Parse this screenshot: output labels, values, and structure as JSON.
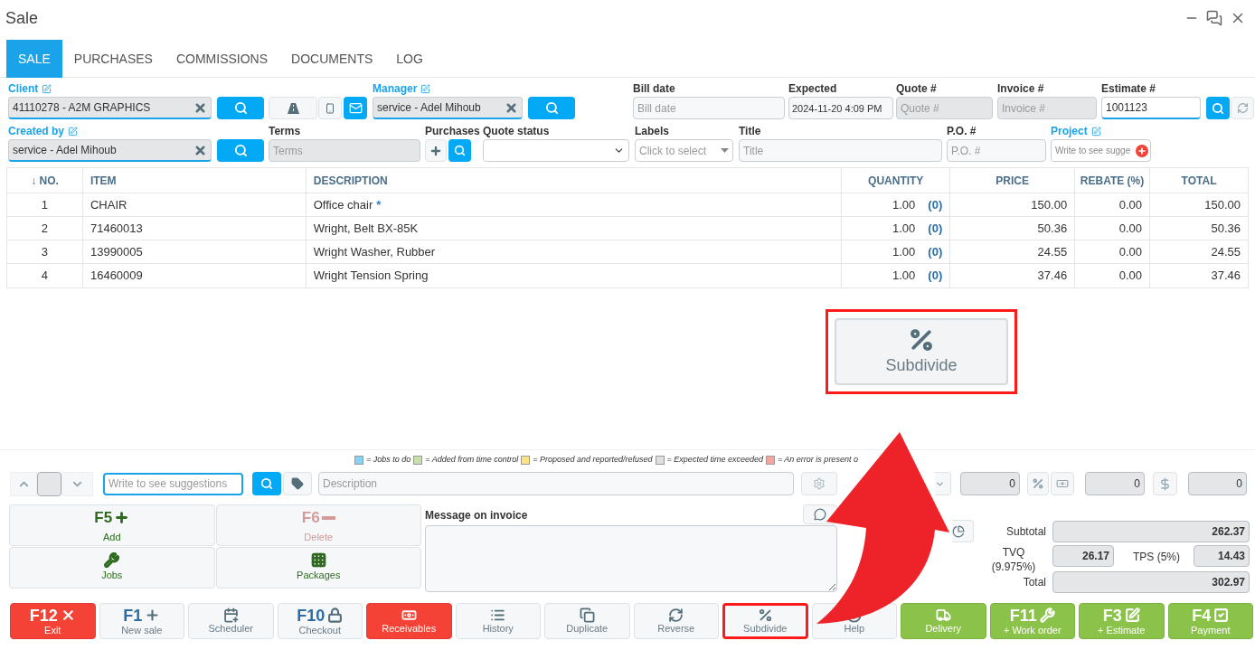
{
  "window": {
    "title": "Sale"
  },
  "tabs": [
    {
      "label": "SALE",
      "selected": true
    },
    {
      "label": "PURCHASES",
      "selected": false
    },
    {
      "label": "COMMISSIONS",
      "selected": false
    },
    {
      "label": "DOCUMENTS",
      "selected": false
    },
    {
      "label": "LOG",
      "selected": false
    }
  ],
  "client": {
    "label": "Client",
    "value": "41110278 - A2M GRAPHICS"
  },
  "manager": {
    "label": "Manager",
    "value": "service - Adel Mihoub"
  },
  "bill_date": {
    "label": "Bill date",
    "placeholder": "Bill date",
    "disabled": false
  },
  "expected": {
    "label": "Expected",
    "value": "2024-11-20 4:09 PM",
    "disabled": false
  },
  "quote_no": {
    "label": "Quote #",
    "placeholder": "Quote #",
    "disabled": true
  },
  "invoice_no": {
    "label": "Invoice #",
    "placeholder": "Invoice #",
    "disabled": true
  },
  "estimate_no": {
    "label": "Estimate #",
    "value": "1001123"
  },
  "created_by": {
    "label": "Created by",
    "value": "service - Adel Mihoub"
  },
  "terms": {
    "label": "Terms",
    "placeholder": "Terms",
    "disabled": true
  },
  "purchases": {
    "label": "Purchases"
  },
  "quote_status": {
    "label": "Quote status"
  },
  "labels": {
    "label": "Labels",
    "placeholder": "Click to select"
  },
  "title": {
    "label": "Title",
    "placeholder": "Title",
    "disabled": false
  },
  "po_no": {
    "label": "P.O. #",
    "placeholder": "P.O. #",
    "disabled": false
  },
  "project": {
    "label": "Project",
    "placeholder": "Write to see sugge"
  },
  "table": {
    "columns": [
      "↓ NO.",
      "ITEM",
      "DESCRIPTION",
      "QUANTITY",
      "PRICE",
      "REBATE (%)",
      "TOTAL"
    ],
    "rows": [
      {
        "no": "1",
        "item": "CHAIR",
        "description": "Office chair",
        "note": "*",
        "quantity": "1.00",
        "reserved": "(0)",
        "price": "150.00",
        "rebate": "0.00",
        "total": "150.00"
      },
      {
        "no": "2",
        "item": "71460013",
        "description": "Wright, Belt BX-85K",
        "quantity": "1.00",
        "reserved": "(0)",
        "price": "50.36",
        "rebate": "0.00",
        "total": "50.36"
      },
      {
        "no": "3",
        "item": "13990005",
        "description": "Wright Washer, Rubber",
        "quantity": "1.00",
        "reserved": "(0)",
        "price": "24.55",
        "rebate": "0.00",
        "total": "24.55"
      },
      {
        "no": "4",
        "item": "16460009",
        "description": "Wright Tension Spring",
        "quantity": "1.00",
        "reserved": "(0)",
        "price": "37.46",
        "rebate": "0.00",
        "total": "37.46"
      }
    ]
  },
  "callout": {
    "label": "Subdivide"
  },
  "legend": [
    {
      "color": "#87d3f5",
      "label": "= Jobs to do"
    },
    {
      "color": "#c5e1a5",
      "label": "= Added from time control"
    },
    {
      "color": "#ffe082",
      "label": "= Proposed and reported/refused"
    },
    {
      "color": "#e0e0e0",
      "label": "= Expected time exceeded"
    },
    {
      "color": "#f4a59f",
      "label": "= An error is present o"
    }
  ],
  "entry": {
    "search_placeholder": "Write to see suggestions",
    "description_placeholder": "Description",
    "values": [
      "0",
      "0",
      "0"
    ]
  },
  "actions": [
    {
      "key": "F5",
      "label": "Add",
      "disabled": false
    },
    {
      "key": "F6",
      "label": "Delete",
      "disabled": true
    },
    {
      "label": "Jobs",
      "disabled": false
    },
    {
      "label": "Packages",
      "disabled": false
    }
  ],
  "message": {
    "label": "Message on invoice"
  },
  "totals": {
    "subtotal": {
      "label": "Subtotal",
      "value": "262.37"
    },
    "tvq": {
      "label": "TVQ (9.975%)",
      "value": "26.17"
    },
    "tps": {
      "label": "TPS (5%)",
      "value": "14.43"
    },
    "total": {
      "label": "Total",
      "value": "302.97"
    }
  },
  "buttons": [
    {
      "key": "F12",
      "label": "Exit",
      "kind": "danger",
      "highlighted": false
    },
    {
      "key": "F1",
      "label": "New sale",
      "kind": "default",
      "highlighted": false
    },
    {
      "label": "Scheduler",
      "kind": "default",
      "highlighted": false
    },
    {
      "key": "F10",
      "label": "Checkout",
      "kind": "default",
      "highlighted": false
    },
    {
      "label": "Receivables",
      "kind": "danger",
      "highlighted": false
    },
    {
      "label": "History",
      "kind": "default",
      "highlighted": false
    },
    {
      "label": "Duplicate",
      "kind": "default",
      "highlighted": false
    },
    {
      "label": "Reverse",
      "kind": "default",
      "highlighted": false
    },
    {
      "label": "Subdivide",
      "kind": "default",
      "highlighted": true
    },
    {
      "label": "Help",
      "kind": "default",
      "highlighted": false
    },
    {
      "label": "Delivery",
      "kind": "success",
      "highlighted": false
    },
    {
      "key": "F11",
      "label": "+ Work order",
      "kind": "success",
      "highlighted": false
    },
    {
      "key": "F3",
      "label": "+ Estimate",
      "kind": "success",
      "highlighted": false
    },
    {
      "key": "F4",
      "label": "Payment",
      "kind": "success",
      "highlighted": false
    }
  ]
}
